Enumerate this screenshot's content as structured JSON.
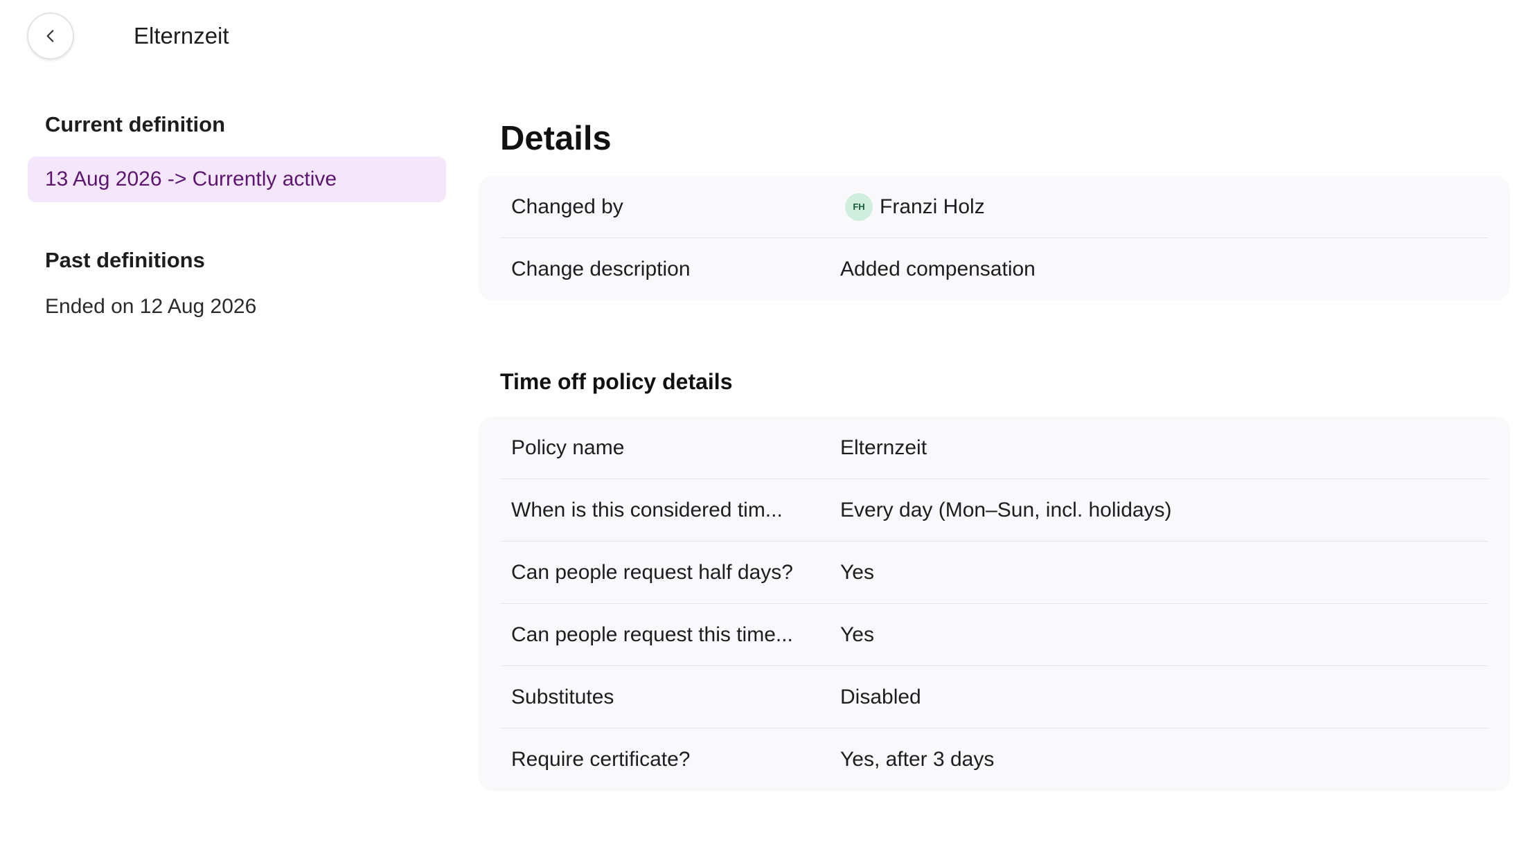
{
  "header": {
    "title": "Elternzeit"
  },
  "sidebar": {
    "current_heading": "Current definition",
    "current_item": "13 Aug 2026 -> Currently active",
    "past_heading": "Past definitions",
    "past_items": [
      "Ended on 12 Aug 2026"
    ]
  },
  "details": {
    "title": "Details",
    "changed_by_label": "Changed by",
    "changed_by_initials": "FH",
    "changed_by_name": "Franzi Holz",
    "change_description_label": "Change description",
    "change_description_value": "Added compensation"
  },
  "policy": {
    "title": "Time off policy details",
    "rows": [
      {
        "label": "Policy name",
        "value": "Elternzeit"
      },
      {
        "label": "When is this considered tim...",
        "value": "Every day (Mon–Sun, incl. holidays)"
      },
      {
        "label": "Can people request half days?",
        "value": "Yes"
      },
      {
        "label": "Can people request this time...",
        "value": "Yes"
      },
      {
        "label": "Substitutes",
        "value": "Disabled"
      },
      {
        "label": "Require certificate?",
        "value": "Yes, after 3 days"
      }
    ]
  },
  "colors": {
    "current_item_bg": "#f5e7fb",
    "current_item_text": "#5c1670",
    "avatar_bg": "#cfeedd",
    "card_bg": "#f9f9fb"
  },
  "icons": {
    "back": "chevron-left-icon"
  }
}
